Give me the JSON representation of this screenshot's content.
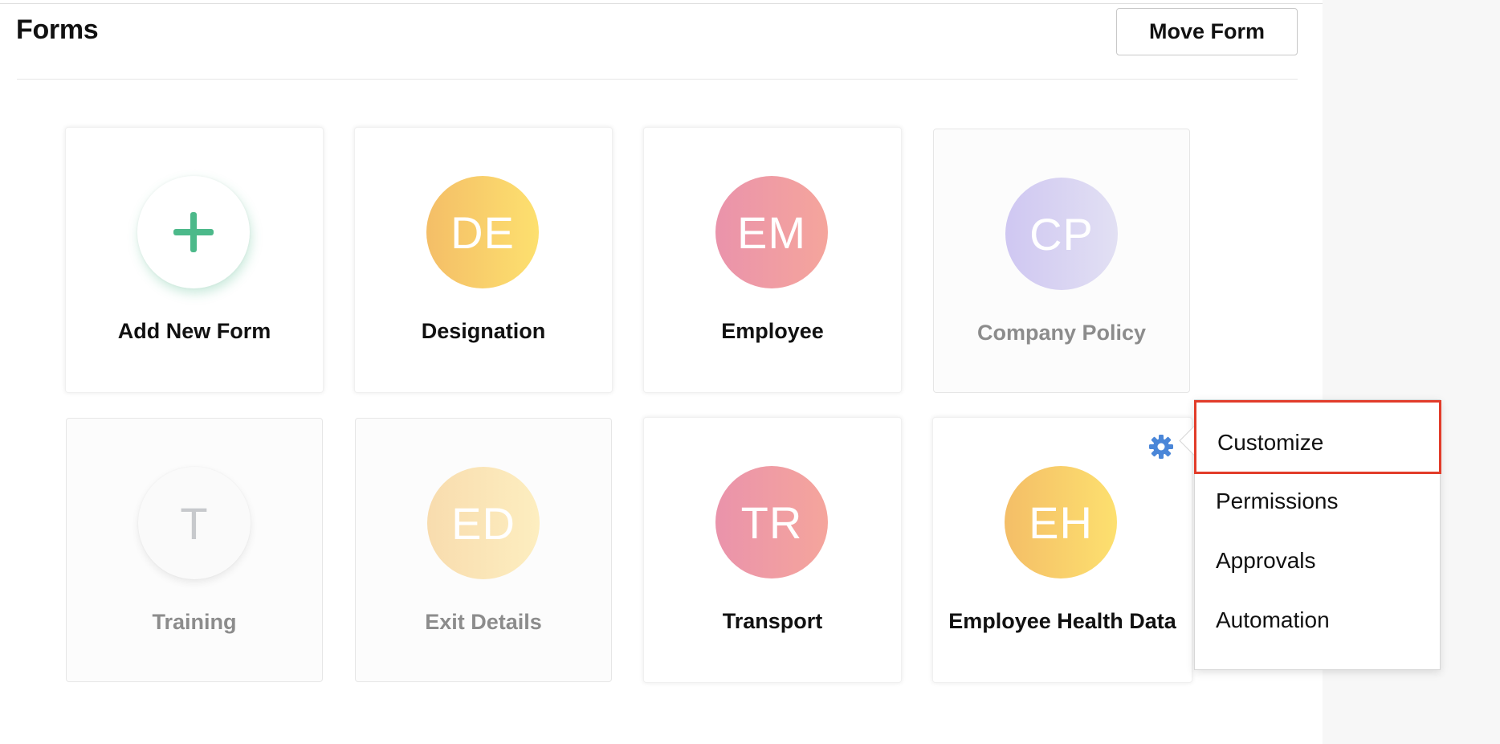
{
  "header": {
    "title": "Forms",
    "move_button_label": "Move Form"
  },
  "cards": [
    {
      "label": "Add New Form",
      "icon": "plus-icon",
      "state": "normal"
    },
    {
      "label": "Designation",
      "initials": "DE",
      "color": "orange",
      "state": "normal"
    },
    {
      "label": "Employee",
      "initials": "EM",
      "color": "pink",
      "state": "normal"
    },
    {
      "label": "Company Policy",
      "initials": "CP",
      "color": "lavender",
      "state": "disabled"
    },
    {
      "label": "Training",
      "initials": "T",
      "color": "gray",
      "state": "disabled"
    },
    {
      "label": "Exit Details",
      "initials": "ED",
      "color": "pale-orange",
      "state": "disabled"
    },
    {
      "label": "Transport",
      "initials": "TR",
      "color": "pink",
      "state": "normal"
    },
    {
      "label": "Employee Health Data",
      "initials": "EH",
      "color": "orange",
      "state": "normal"
    }
  ],
  "context_menu": {
    "trigger_icon": "gear-icon",
    "items": [
      {
        "label": "Customize",
        "highlighted": true
      },
      {
        "label": "Permissions"
      },
      {
        "label": "Approvals"
      },
      {
        "label": "Automation"
      }
    ]
  },
  "colors": {
    "plus_green": "#4cb98a",
    "gear_blue": "#4a86d8",
    "highlight_red": "#e23c2a",
    "orange_start": "#f4be67",
    "orange_end": "#fde06f",
    "pink_start": "#ea93ab",
    "pink_end": "#f5a59c",
    "lavender_start": "#cfc7f2",
    "lavender_end": "#e2e0f3"
  }
}
